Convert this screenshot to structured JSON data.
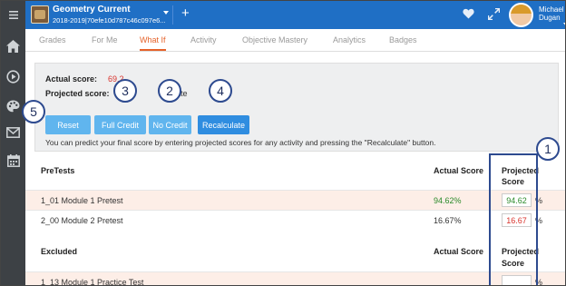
{
  "topbar": {
    "course_title": "Geometry Current",
    "course_subtitle": "2018-2019|70efe10d787c46c097e6...",
    "add_label": "+",
    "user_first": "Michael",
    "user_last": "Dugan"
  },
  "rail": {
    "items": [
      "menu-icon",
      "home-icon",
      "play-circle-icon",
      "palette-icon",
      "mail-icon",
      "calendar-icon"
    ]
  },
  "tabs": [
    {
      "label": "Grades"
    },
    {
      "label": "For Me"
    },
    {
      "label": "What If",
      "active": true
    },
    {
      "label": "Activity"
    },
    {
      "label": "Objective Mastery"
    },
    {
      "label": "Analytics"
    },
    {
      "label": "Badges"
    }
  ],
  "whatif": {
    "actual_label": "Actual score:",
    "actual_value": "69.2",
    "projected_label": "Projected score:",
    "projected_partial": "ulate",
    "buttons": {
      "reset": "Reset",
      "full_credit": "Full Credit",
      "no_credit": "No Credit",
      "recalculate": "Recalculate"
    },
    "note": "You can predict your final score by entering projected scores for any activity and pressing the \"Recalculate\" button."
  },
  "sections": [
    {
      "title": "PreTests",
      "actual_header": "Actual Score",
      "projected_header_1": "Projected",
      "projected_header_2": "Score",
      "rows": [
        {
          "name": "1_01 Module 1 Pretest",
          "actual": "94.62%",
          "projected": "94.62",
          "pct": "%"
        },
        {
          "name": "2_00 Module 2 Pretest",
          "actual": "16.67%",
          "projected": "16.67",
          "pct": "%"
        }
      ]
    },
    {
      "title": "Excluded",
      "actual_header": "Actual Score",
      "projected_header_1": "Projected",
      "projected_header_2": "Score",
      "rows": [
        {
          "name": "1_13 Module 1 Practice Test",
          "actual": "",
          "projected": "",
          "pct": "%"
        }
      ]
    }
  ],
  "callouts": {
    "one": "1",
    "two": "2",
    "three": "3",
    "four": "4",
    "five": "5"
  },
  "colors": {
    "topbar": "#1f6fc5",
    "rail": "#3d4145",
    "active_tab": "#e5622a",
    "button": "#60b5ee",
    "button_primary": "#2f8de0",
    "score_high": "#2a8a2a",
    "score_low": "#d9332d",
    "row_highlight": "#fdeee7",
    "callout": "#2d4a8f"
  }
}
